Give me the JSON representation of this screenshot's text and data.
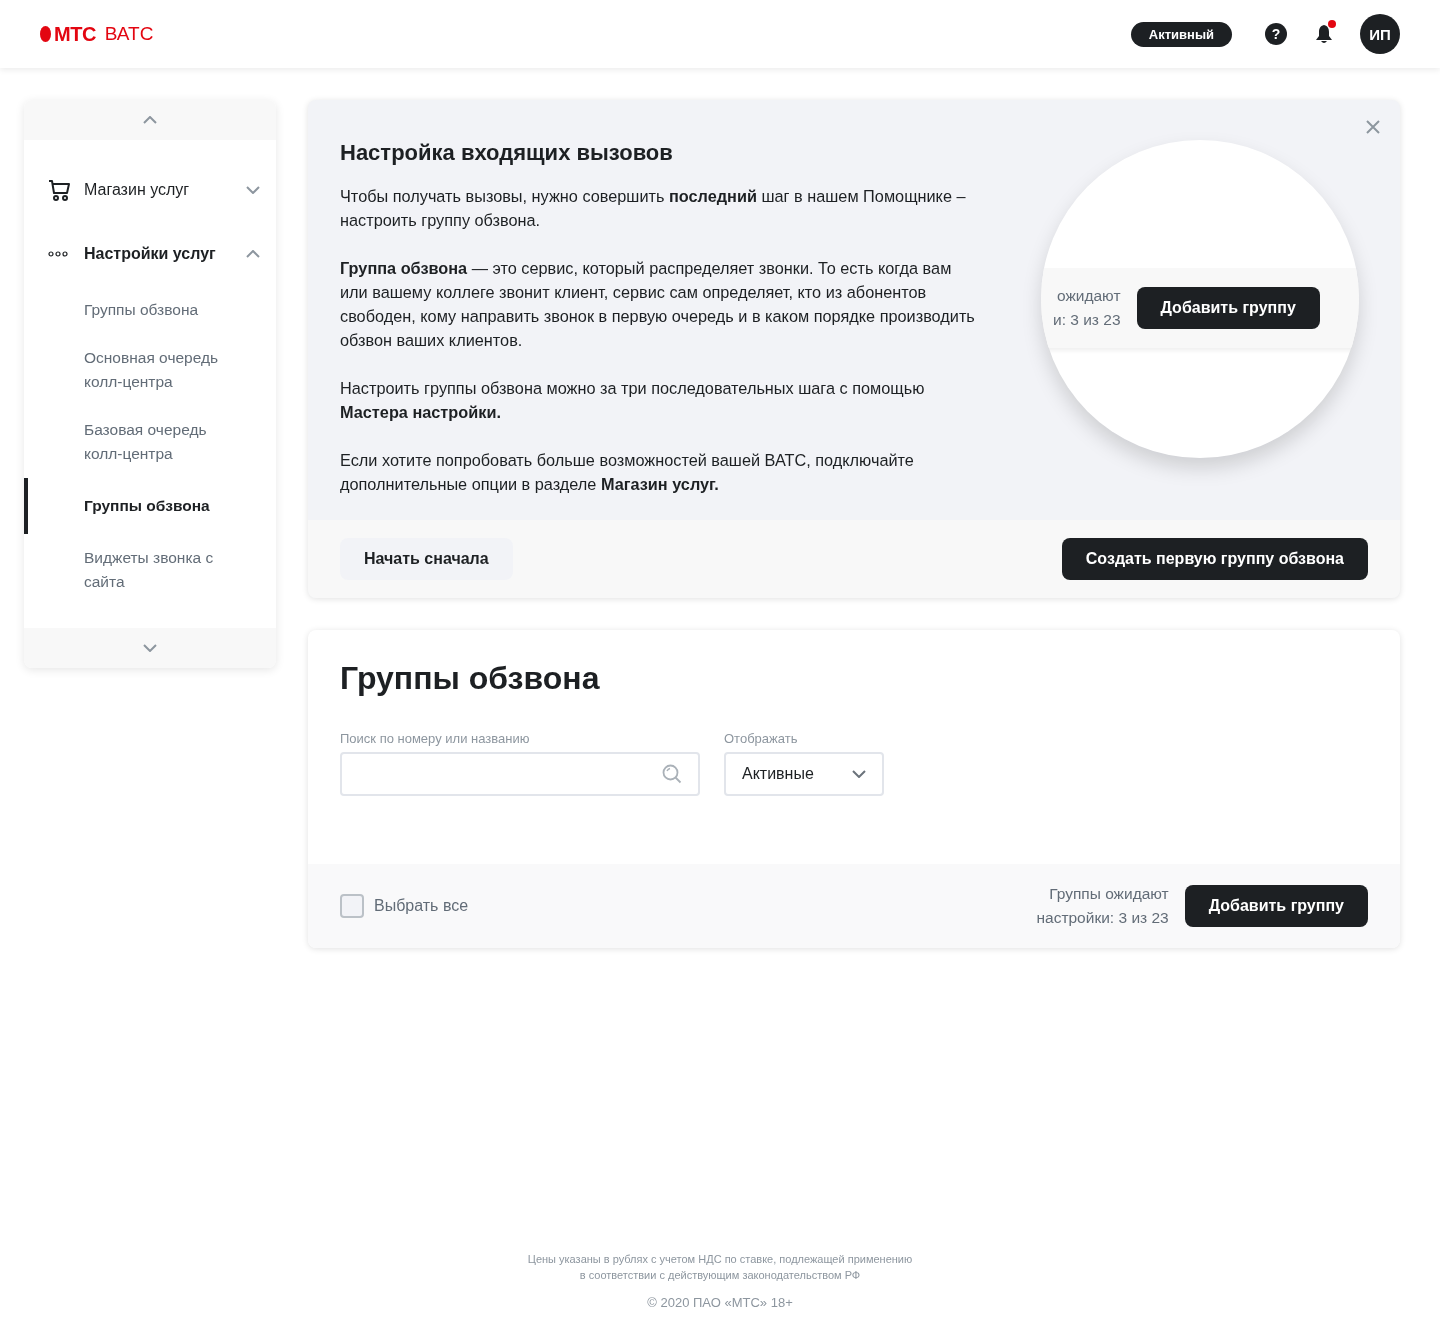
{
  "header": {
    "logo": {
      "brand": "МТС",
      "product": "ВАТС"
    },
    "status_badge": "Активный",
    "help": "?",
    "notifications": {
      "unread": true
    },
    "avatar": "ИП"
  },
  "sidebar": {
    "items": [
      {
        "kind": "group",
        "label": "Магазин услуг",
        "expanded": false
      },
      {
        "kind": "group",
        "label": "Настройки услуг",
        "expanded": true,
        "children": [
          {
            "label": "Группы обзвона",
            "selected": false
          },
          {
            "label": "Основная очередь колл-центра",
            "selected": false
          },
          {
            "label": "Базовая очередь колл-центра",
            "selected": false
          },
          {
            "label": "Группы обзвона",
            "selected": true
          },
          {
            "label": "Виджеты звонка с сайта",
            "selected": false
          }
        ]
      }
    ]
  },
  "wizard": {
    "title": "Настройка входящих вызовов",
    "paragraphs": [
      "Чтобы получать вызовы, нужно совершить **последний** шаг в нашем Помощнике – настроить группу обзвона.",
      "**Группа обзвона** — это сервис, который распределяет звонки. То есть когда вам или вашему коллеге звонит клиент, сервис сам определяет, кто из абонентов свободен, кому направить звонок в первую очередь и в каком порядке производить обзвон ваших клиентов.",
      "Настроить группы обзвона можно за три последовательных  шага с помощью **Мастера настройки.**",
      "Если хотите попробовать больше возможностей вашей ВАТС, подключайте дополнительные опции в разделе **Магазин услуг.**"
    ],
    "preview": {
      "status_lines": [
        "ожидают",
        "и: 3 из 23"
      ],
      "button": "Добавить группу"
    },
    "restart_button": "Начать сначала",
    "create_button": "Создать первую группу обзвона"
  },
  "groups": {
    "title": "Группы обзвона",
    "search": {
      "label": "Поиск по номеру или названию"
    },
    "display": {
      "label": "Отображать",
      "value": "Активные"
    },
    "select_all": {
      "label": "Выбрать все",
      "checked": false
    },
    "status_lines": [
      "Группы ожидают",
      "настройки: 3 из 23"
    ],
    "add_button": "Добавить группу"
  },
  "footer": {
    "notice_lines": [
      "Цены указаны в рублях с учетом НДС по ставке, подлежащей применению",
      "в соответствии с действующим законодательством РФ"
    ],
    "copyright": "© 2020 ПАО «МТС» 18+"
  }
}
